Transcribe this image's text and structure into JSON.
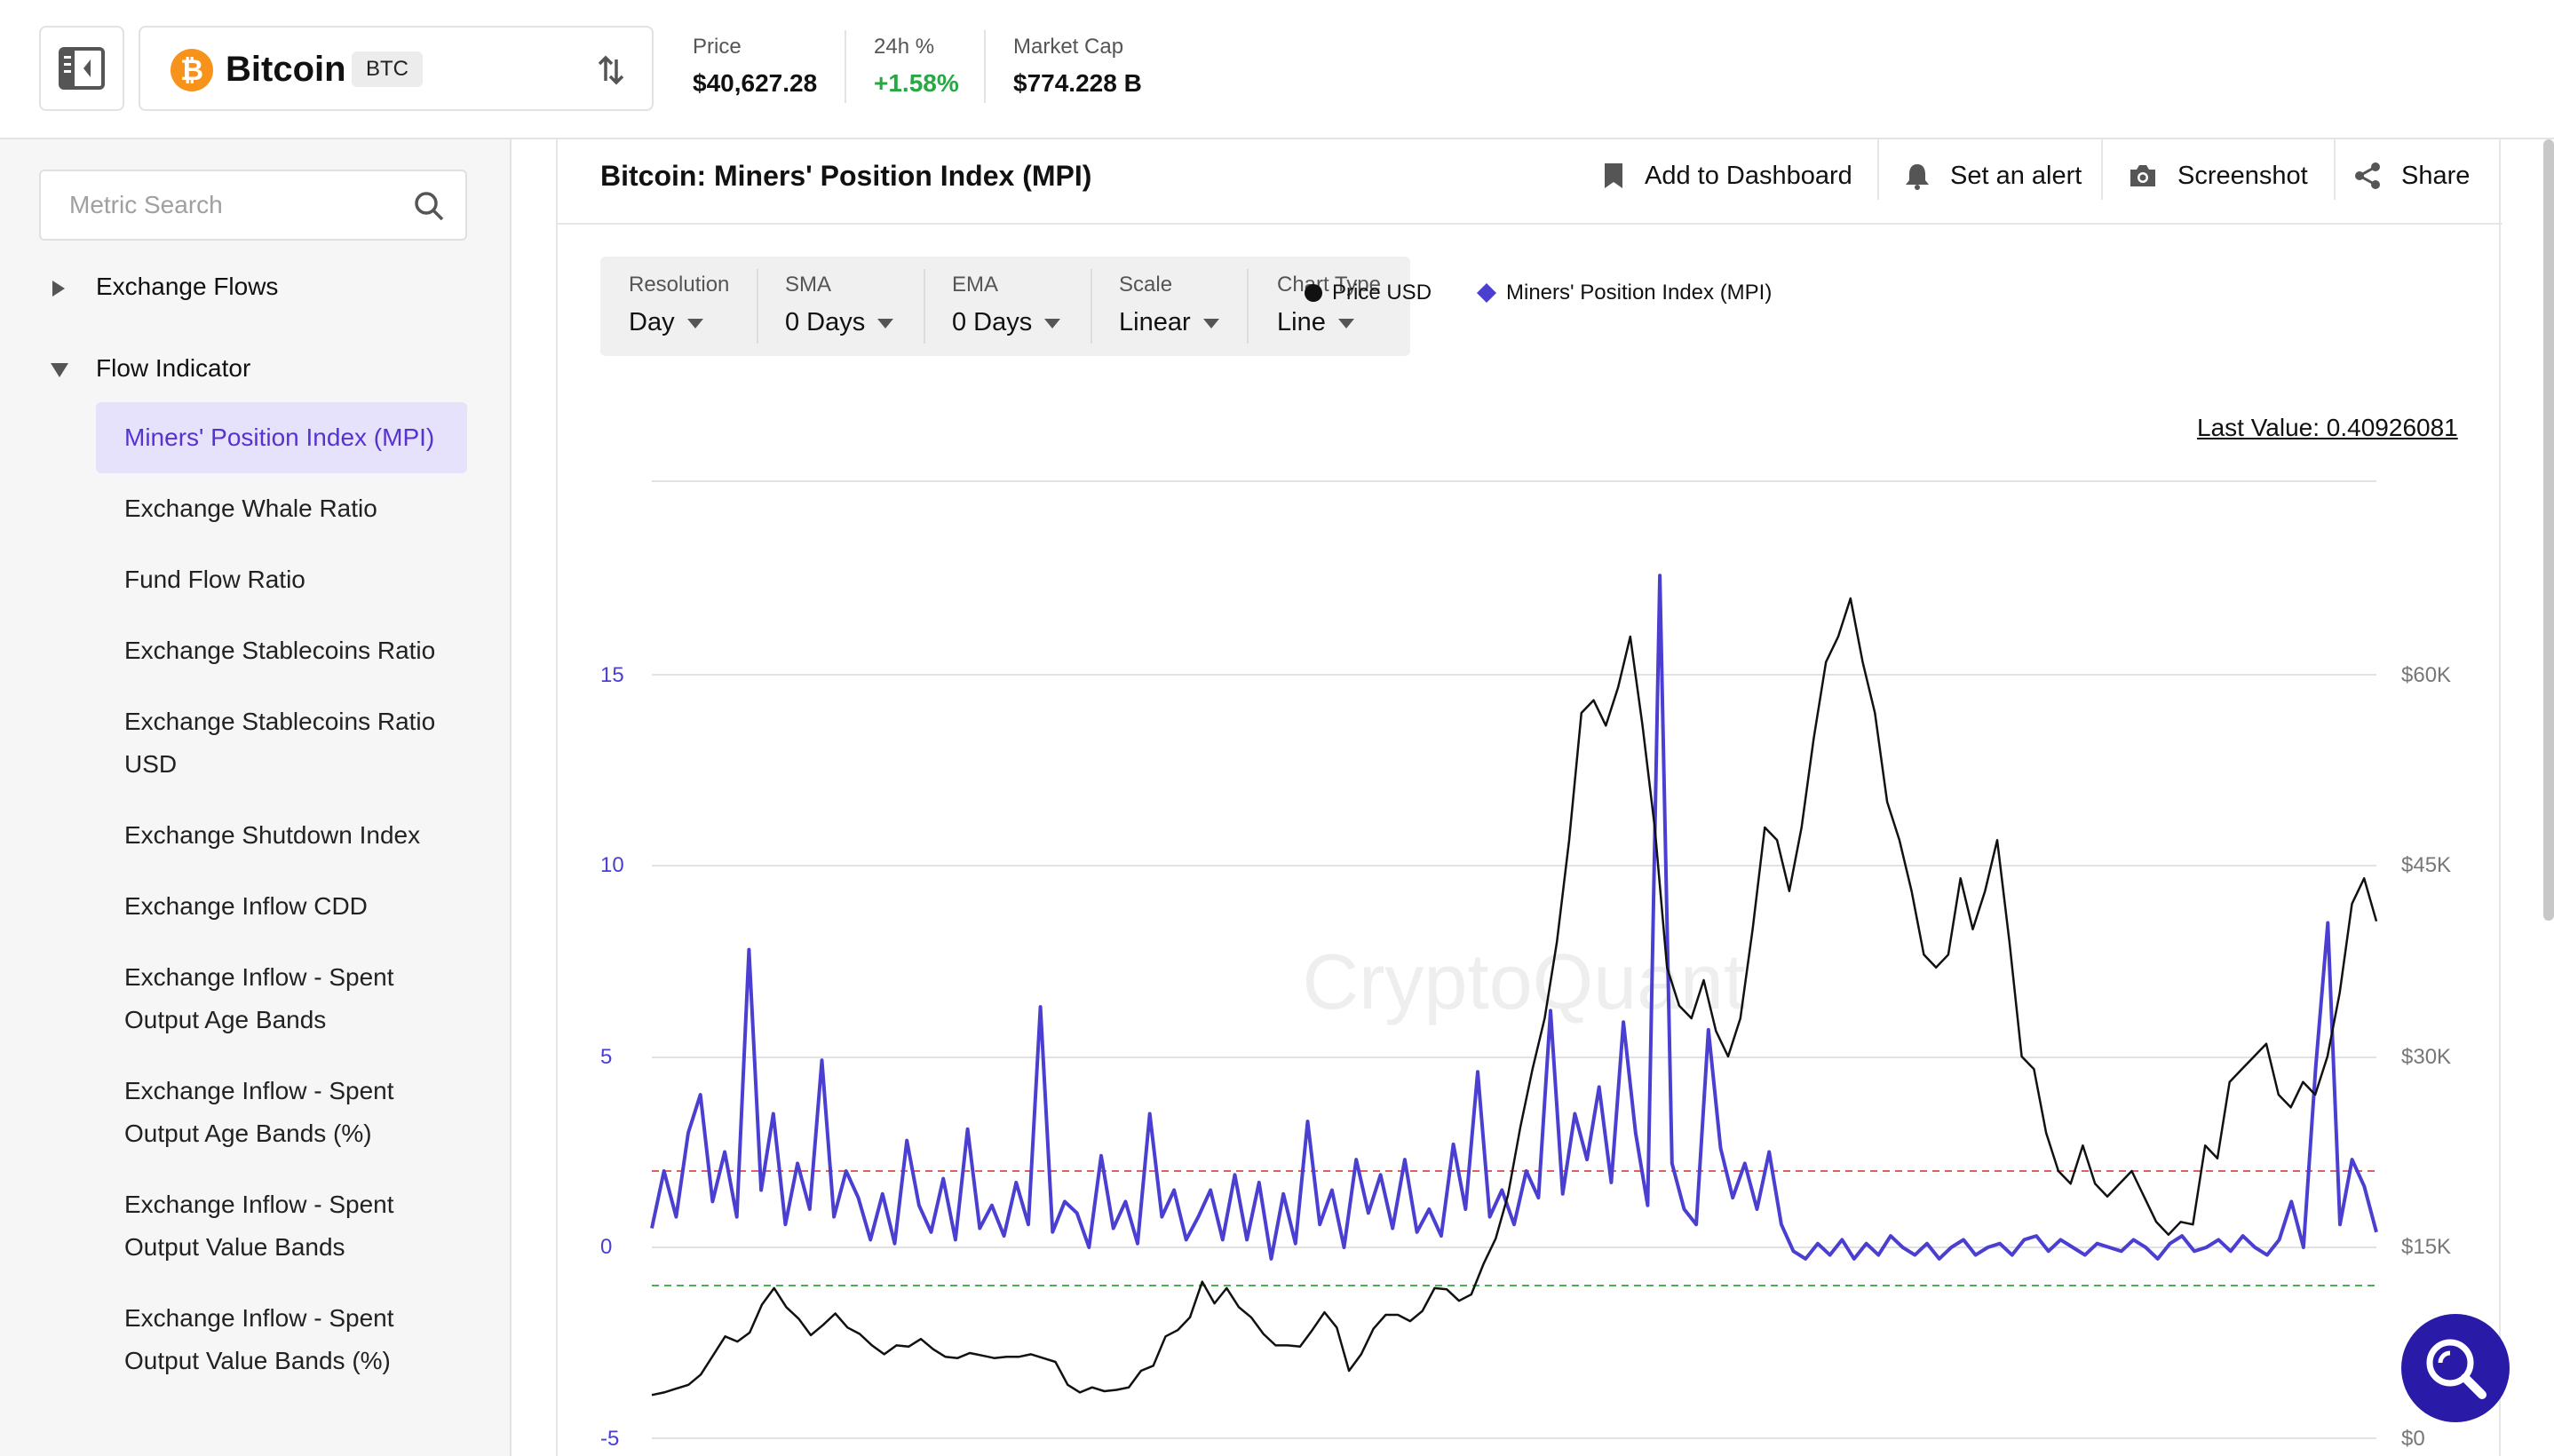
{
  "header": {
    "asset_name": "Bitcoin",
    "ticker": "BTC",
    "price_label": "Price",
    "price_value": "$40,627.28",
    "change_label": "24h %",
    "change_value": "+1.58%",
    "market_cap_label": "Market Cap",
    "market_cap_value": "$774.228 B"
  },
  "sidebar": {
    "search_placeholder": "Metric Search",
    "groups": [
      {
        "label": "Exchange Flows",
        "expanded": false
      },
      {
        "label": "Flow Indicator",
        "expanded": true
      }
    ],
    "items": [
      {
        "label": "Miners' Position Index (MPI)",
        "active": true
      },
      {
        "label": "Exchange Whale Ratio"
      },
      {
        "label": "Fund Flow Ratio"
      },
      {
        "label": "Exchange Stablecoins Ratio"
      },
      {
        "label": "Exchange Stablecoins Ratio USD"
      },
      {
        "label": "Exchange Shutdown Index"
      },
      {
        "label": "Exchange Inflow CDD"
      },
      {
        "label": "Exchange Inflow - Spent Output Age Bands"
      },
      {
        "label": "Exchange Inflow - Spent Output Age Bands (%)"
      },
      {
        "label": "Exchange Inflow - Spent Output Value Bands"
      },
      {
        "label": "Exchange Inflow - Spent Output Value Bands (%)"
      }
    ]
  },
  "main": {
    "title": "Bitcoin: Miners' Position Index (MPI)",
    "actions": {
      "add_dashboard": "Add to Dashboard",
      "set_alert": "Set an alert",
      "screenshot": "Screenshot",
      "share": "Share"
    },
    "controls": [
      {
        "label": "Resolution",
        "value": "Day"
      },
      {
        "label": "SMA",
        "value": "0 Days"
      },
      {
        "label": "EMA",
        "value": "0 Days"
      },
      {
        "label": "Scale",
        "value": "Linear"
      },
      {
        "label": "Chart Type",
        "value": "Line"
      }
    ],
    "last_value": "Last Value: 0.40926081",
    "watermark": "CryptoQuant"
  },
  "chart_data": {
    "type": "line",
    "title": "",
    "legend": [
      "Price USD",
      "Miners' Position Index (MPI)"
    ],
    "legend_placement": "top-center",
    "y_left": {
      "ticks": [
        "15",
        "10",
        "5",
        "0",
        "-5"
      ],
      "range": [
        -5,
        20
      ]
    },
    "y_right": {
      "ticks": [
        "$60K",
        "$45K",
        "$30K",
        "$15K",
        "$0"
      ],
      "range": [
        0,
        75000
      ]
    },
    "threshold_lines": [
      {
        "value": 2,
        "color": "#e06060",
        "style": "dashed"
      },
      {
        "value": -1,
        "color": "#4caf50",
        "style": "dashed"
      }
    ],
    "series": [
      {
        "name": "Price USD",
        "axis": "right",
        "color": "#111111",
        "values": [
          3400,
          3600,
          3900,
          4200,
          5000,
          6500,
          8000,
          7600,
          8300,
          10500,
          11800,
          10300,
          9400,
          8100,
          8900,
          9800,
          8700,
          8200,
          7300,
          6600,
          7300,
          7200,
          7800,
          7000,
          6400,
          6300,
          6700,
          6500,
          6300,
          6400,
          6400,
          6600,
          6300,
          6000,
          4200,
          3600,
          4000,
          3700,
          3800,
          4000,
          5300,
          5700,
          8000,
          8500,
          9500,
          12300,
          10600,
          11800,
          10300,
          9500,
          8200,
          7300,
          7300,
          7200,
          8500,
          9900,
          8700,
          5300,
          6600,
          8600,
          9700,
          9700,
          9200,
          10000,
          11800,
          11700,
          10800,
          11300,
          13700,
          15700,
          19100,
          24400,
          29000,
          33000,
          39000,
          47000,
          57000,
          58000,
          56000,
          59000,
          63000,
          56000,
          48000,
          37000,
          34000,
          33000,
          36000,
          32000,
          30000,
          33000,
          40000,
          48000,
          47000,
          43000,
          48000,
          55000,
          61000,
          63000,
          66000,
          61000,
          57000,
          50000,
          47000,
          43000,
          38000,
          37000,
          38000,
          44000,
          40000,
          43000,
          47000,
          39000,
          30000,
          29000,
          24000,
          21000,
          20000,
          23000,
          20000,
          19000,
          20000,
          21000,
          19000,
          17000,
          16000,
          17000,
          16800,
          23000,
          22000,
          28000,
          29000,
          30000,
          31000,
          27000,
          26000,
          28000,
          27000,
          30000,
          35000,
          42000,
          44000,
          40627
        ]
      },
      {
        "name": "Miners' Position Index (MPI)",
        "axis": "left",
        "color": "#4a3fd1",
        "values": [
          0.5,
          2,
          0.8,
          3,
          4,
          1.2,
          2.5,
          0.8,
          7.8,
          1.5,
          3.5,
          0.6,
          2.2,
          1,
          4.9,
          0.8,
          2,
          1.3,
          0.2,
          1.4,
          0.1,
          2.8,
          1.1,
          0.4,
          1.8,
          0.2,
          3.1,
          0.5,
          1.1,
          0.3,
          1.7,
          0.6,
          6.3,
          0.4,
          1.2,
          0.9,
          0,
          2.4,
          0.5,
          1.2,
          0.1,
          3.5,
          0.8,
          1.5,
          0.2,
          0.8,
          1.5,
          0.2,
          1.9,
          0.2,
          1.7,
          -0.3,
          1.4,
          0.1,
          3.3,
          0.6,
          1.5,
          0,
          2.3,
          0.9,
          1.9,
          0.5,
          2.3,
          0.4,
          1,
          0.3,
          2.7,
          1,
          4.6,
          0.8,
          1.5,
          0.6,
          2,
          1.3,
          6.2,
          1.4,
          3.5,
          2.3,
          4.2,
          1.7,
          5.9,
          3,
          1.1,
          17.6,
          2.2,
          1,
          0.6,
          5.7,
          2.6,
          1.3,
          2.2,
          1,
          2.5,
          0.6,
          -0.1,
          -0.3,
          0.1,
          -0.2,
          0.2,
          -0.3,
          0.1,
          -0.2,
          0.3,
          0,
          -0.2,
          0.1,
          -0.3,
          0,
          0.2,
          -0.2,
          0,
          0.1,
          -0.2,
          0.2,
          0.3,
          -0.1,
          0.2,
          0,
          -0.2,
          0.1,
          0,
          -0.1,
          0.2,
          0,
          -0.3,
          0.1,
          0.3,
          -0.1,
          0,
          0.2,
          -0.1,
          0.3,
          0,
          -0.2,
          0.2,
          1.2,
          0,
          4.7,
          8.5,
          0.6,
          2.3,
          1.6,
          0.4
        ]
      }
    ]
  }
}
